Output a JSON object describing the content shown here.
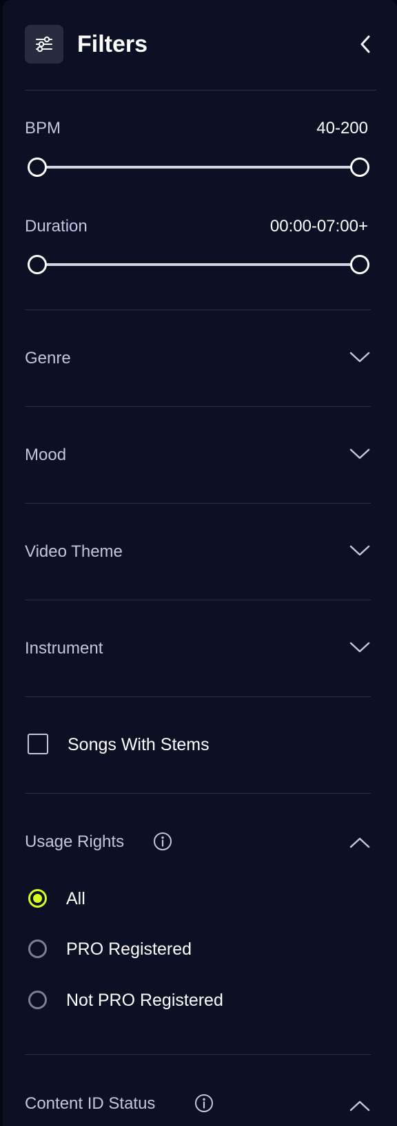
{
  "header": {
    "title": "Filters",
    "icon": "sliders-icon",
    "collapse_icon": "chevron-left-icon"
  },
  "bpm": {
    "label": "BPM",
    "range_text": "40-200",
    "min": 40,
    "max": 200,
    "selected_min": 40,
    "selected_max": 200
  },
  "duration": {
    "label": "Duration",
    "range_text": "00:00-07:00+",
    "selected_min_fraction": 0,
    "selected_max_fraction": 1
  },
  "sections": {
    "genre": {
      "label": "Genre",
      "expanded": false
    },
    "mood": {
      "label": "Mood",
      "expanded": false
    },
    "video_theme": {
      "label": "Video Theme",
      "expanded": false
    },
    "instrument": {
      "label": "Instrument",
      "expanded": false
    }
  },
  "stems": {
    "label": "Songs With Stems",
    "checked": false
  },
  "usage_rights": {
    "label": "Usage Rights",
    "expanded": true,
    "options": [
      {
        "label": "All",
        "selected": true
      },
      {
        "label": "PRO Registered",
        "selected": false
      },
      {
        "label": "Not PRO Registered",
        "selected": false
      }
    ]
  },
  "content_id": {
    "label": "Content ID Status",
    "expanded": true
  },
  "colors": {
    "panel_bg": "#0b1024",
    "accent": "#d6ff1f",
    "label": "#c5c5e2",
    "divider": "#2b3043"
  }
}
